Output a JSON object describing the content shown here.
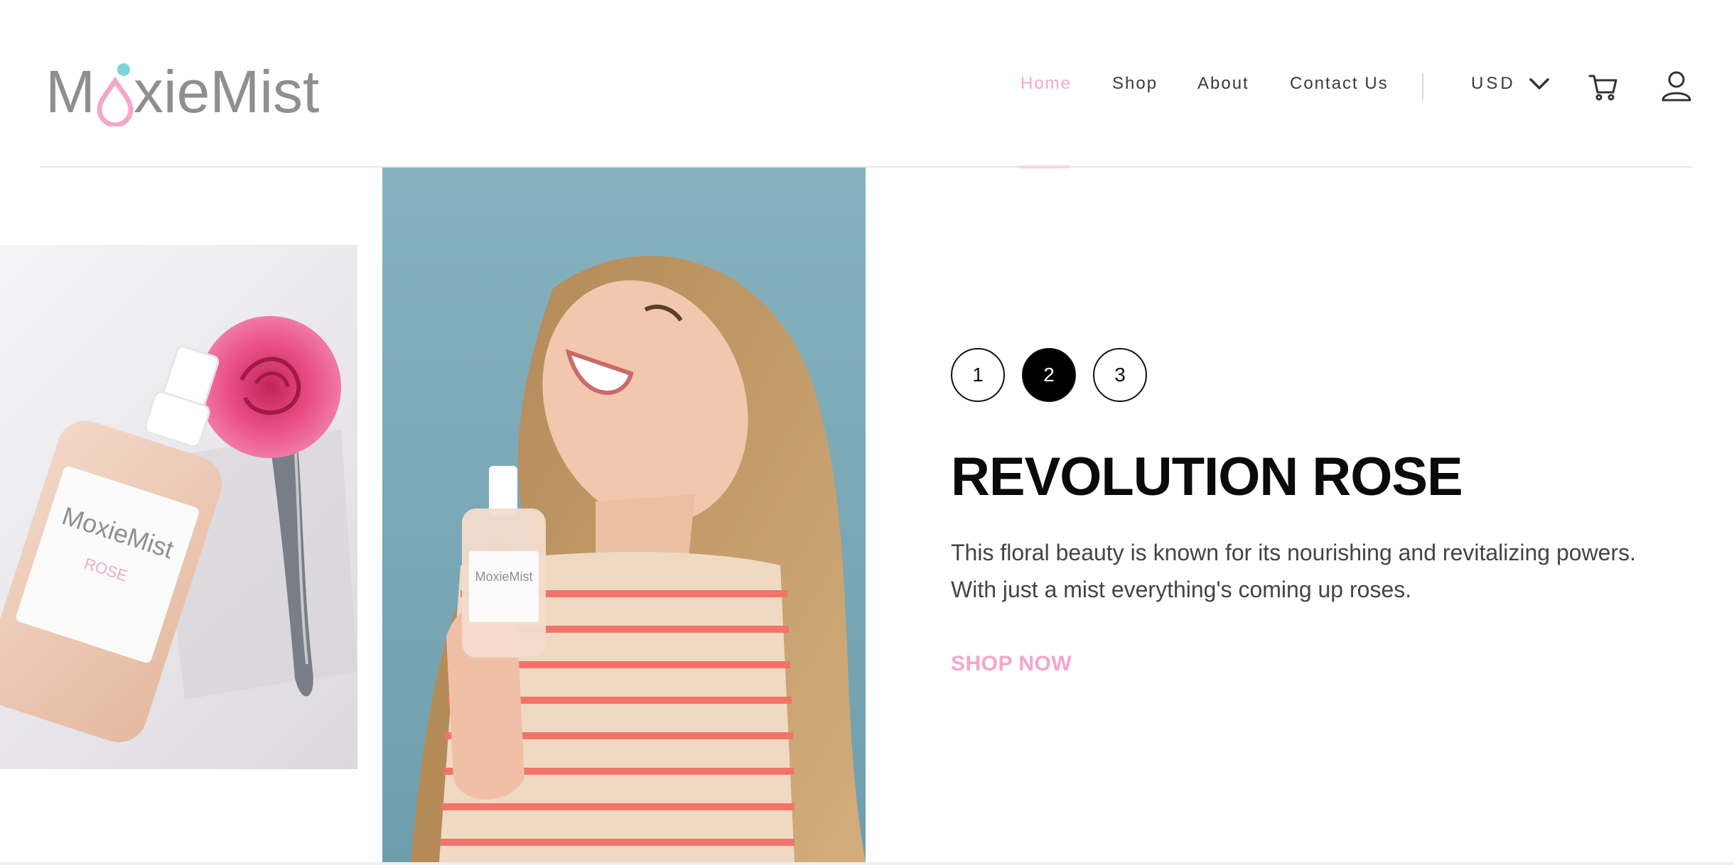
{
  "brand": {
    "logo_text_1": "M",
    "logo_text_2": "xieMist",
    "logo_full": "MoxieMist",
    "gray": "#8f8f8f",
    "pink": "#f2a9c9",
    "aqua": "#7fd4dc"
  },
  "nav": {
    "items": [
      {
        "label": "Home",
        "active": true
      },
      {
        "label": "Shop",
        "active": false
      },
      {
        "label": "About",
        "active": false
      },
      {
        "label": "Contact Us",
        "active": false
      }
    ],
    "currency": "USD",
    "cart_icon": "cart-icon",
    "user_icon": "user-icon",
    "chevron_icon": "chevron-down-icon"
  },
  "slider": {
    "dots": [
      "1",
      "2",
      "3"
    ],
    "active_index": 1
  },
  "hero": {
    "title": "REVOLUTION ROSE",
    "description": "This floral beauty is known for its nourishing and revitalizing powers. With just a mist everything's coming up roses.",
    "cta": "SHOP NOW",
    "cta_color": "#f4a5cc"
  },
  "product_label": {
    "brand": "MoxieMist",
    "variant": "ROSE"
  }
}
